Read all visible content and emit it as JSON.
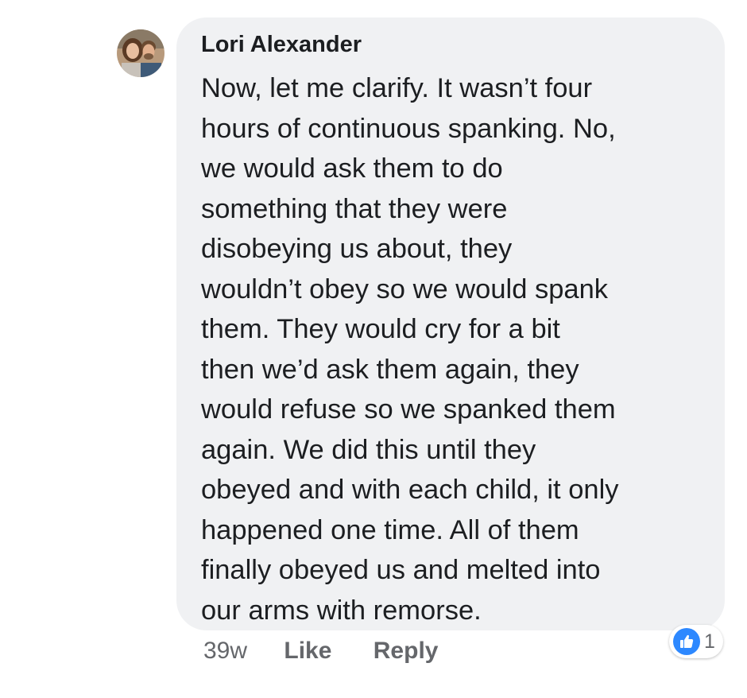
{
  "comment": {
    "author": "Lori Alexander",
    "text_lines": [
      "Now, let me clarify. It wasn’t four",
      "hours of continuous spanking. No,",
      "we would ask them to do",
      "something that they were",
      "disobeying us about, they",
      "wouldn’t obey so we would spank",
      "them. They would cry for a bit",
      "then we’d ask them again, they",
      "would refuse so we spanked them",
      "again. We did this until they",
      "obeyed and with each child, it only",
      "happened one time. All of them",
      "finally obeyed us and melted into",
      "our arms with remorse."
    ],
    "timestamp": "39w",
    "like_label": "Like",
    "reply_label": "Reply",
    "reaction_count": "1"
  },
  "icons": {
    "avatar": "profile-photo-avatar",
    "reaction": "thumbs-up-icon"
  },
  "colors": {
    "bubble_background": "#f0f1f3",
    "text": "#1c1e21",
    "secondary_text": "#65676b",
    "like_blue": "#2d88ff"
  }
}
